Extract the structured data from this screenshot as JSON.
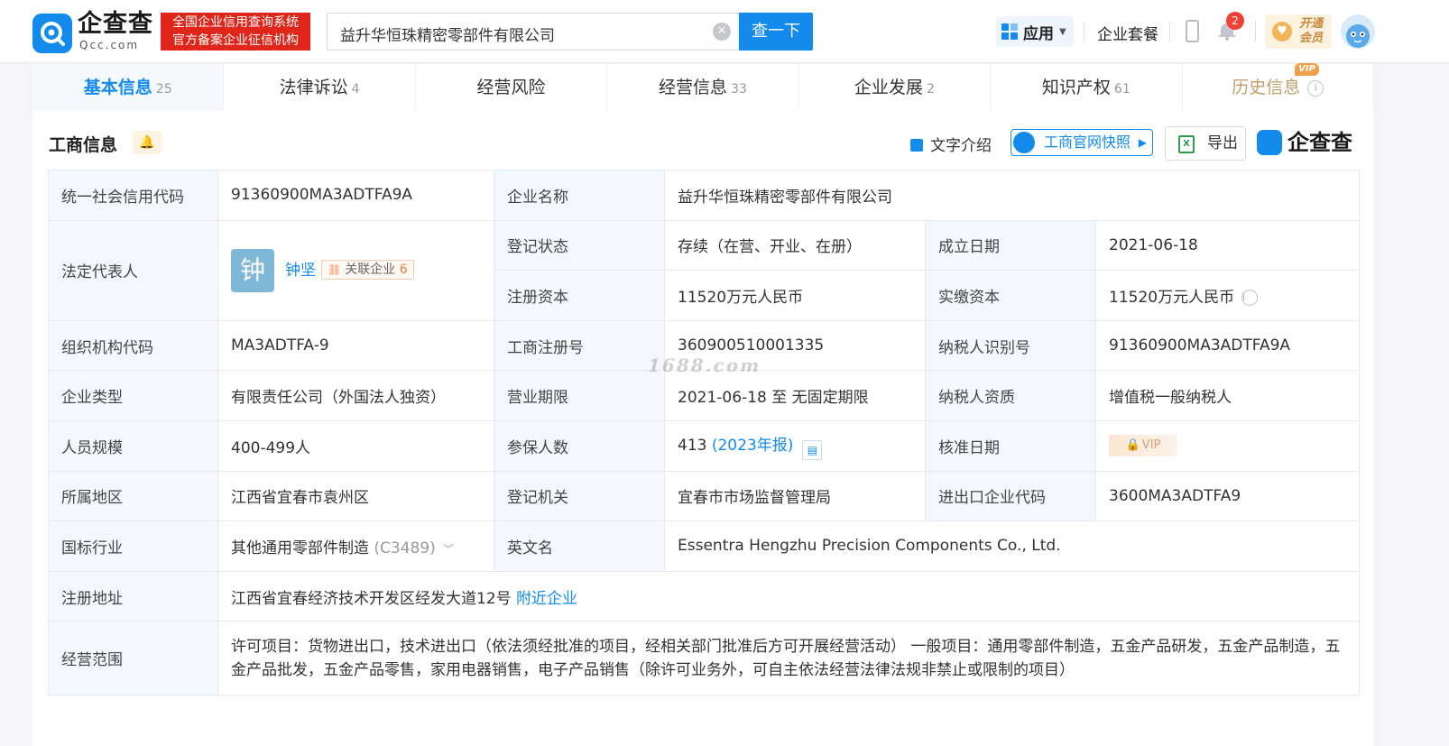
{
  "header": {
    "logo_text": "企查查",
    "logo_sub": "Qcc.com",
    "slogan_line1": "全国企业信用查询系统",
    "slogan_line2": "官方备案企业征信机构",
    "search_value": "益升华恒珠精密零部件有限公司",
    "search_button": "查一下",
    "app_label": "应用",
    "package_label": "企业套餐",
    "notification_count": "2",
    "vip_line1": "开通",
    "vip_line2": "会员"
  },
  "tabs": [
    {
      "label": "基本信息",
      "count": "25"
    },
    {
      "label": "法律诉讼",
      "count": "4"
    },
    {
      "label": "经营风险",
      "count": ""
    },
    {
      "label": "经营信息",
      "count": "33"
    },
    {
      "label": "企业发展",
      "count": "2"
    },
    {
      "label": "知识产权",
      "count": "61"
    },
    {
      "label": "历史信息",
      "count": "",
      "tag": "VIP"
    }
  ],
  "section": {
    "title": "工商信息",
    "text_intro": "文字介绍",
    "snapshot": "工商官网快照",
    "export": "导出",
    "brand": "企查查"
  },
  "info": {
    "credit_code_label": "统一社会信用代码",
    "credit_code": "91360900MA3ADTFA9A",
    "company_name_label": "企业名称",
    "company_name": "益升华恒珠精密零部件有限公司",
    "legal_rep_label": "法定代表人",
    "legal_rep_avatar": "钟",
    "legal_rep_name": "钟坚",
    "related_label": "关联企业",
    "related_count": "6",
    "reg_status_label": "登记状态",
    "reg_status": "存续（在营、开业、在册）",
    "found_date_label": "成立日期",
    "found_date": "2021-06-18",
    "reg_capital_label": "注册资本",
    "reg_capital": "11520万元人民币",
    "paid_capital_label": "实缴资本",
    "paid_capital": "11520万元人民币",
    "org_code_label": "组织机构代码",
    "org_code": "MA3ADTFA-9",
    "biz_reg_no_label": "工商注册号",
    "biz_reg_no": "360900510001335",
    "taxpayer_id_label": "纳税人识别号",
    "taxpayer_id": "91360900MA3ADTFA9A",
    "company_type_label": "企业类型",
    "company_type": "有限责任公司（外国法人独资）",
    "biz_term_label": "营业期限",
    "biz_term": "2021-06-18 至 无固定期限",
    "taxpayer_qual_label": "纳税人资质",
    "taxpayer_qual": "增值税一般纳税人",
    "staff_size_label": "人员规模",
    "staff_size": "400-499人",
    "insured_label": "参保人数",
    "insured_count": "413",
    "insured_year": "(2023年报)",
    "approve_date_label": "核准日期",
    "approve_date_locked": "VIP",
    "region_label": "所属地区",
    "region": "江西省宜春市袁州区",
    "reg_authority_label": "登记机关",
    "reg_authority": "宜春市市场监督管理局",
    "import_export_label": "进出口企业代码",
    "import_export_code": "3600MA3ADTFA9",
    "industry_label": "国标行业",
    "industry": "其他通用零部件制造",
    "industry_code": "(C3489)",
    "english_name_label": "英文名",
    "english_name": "Essentra Hengzhu Precision Components Co., Ltd.",
    "address_label": "注册地址",
    "address": "江西省宜春经济技术开发区经发大道12号",
    "nearby_link": "附近企业",
    "scope_label": "经营范围",
    "scope": "许可项目：货物进出口，技术进出口（依法须经批准的项目，经相关部门批准后方可开展经营活动） 一般项目：通用零部件制造，五金产品研发，五金产品制造，五金产品批发，五金产品零售，家用电器销售，电子产品销售（除许可业务外，可自主依法经营法律法规非禁止或限制的项目）"
  },
  "watermark": "1688.com",
  "colors": {
    "brand": "#128bed",
    "slogan_bg": "#e0261b",
    "label_bg": "#f2f8fe"
  }
}
